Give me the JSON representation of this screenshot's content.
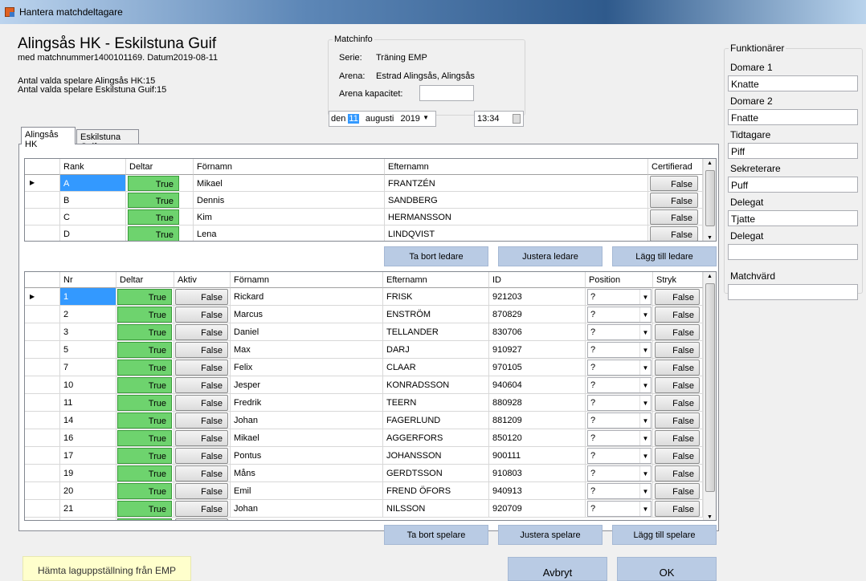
{
  "window": {
    "title": "Hantera matchdeltagare"
  },
  "header": {
    "title": "Alingsås HK - Eskilstuna Guif",
    "subtitle": "med matchnummer1400101169. Datum2019-08-11",
    "selected_home": "Antal valda spelare Alingsås HK:15",
    "selected_away": "Antal valda spelare Eskilstuna Guif:15"
  },
  "matchinfo": {
    "legend": "Matchinfo",
    "serie_label": "Serie:",
    "serie_value": "Träning EMP",
    "arena_label": "Arena:",
    "arena_value": "Estrad Alingsås, Alingsås",
    "capacity_label": "Arena kapacitet:",
    "capacity_value": ""
  },
  "date": {
    "prefix": "den",
    "day": "11",
    "month": "augusti",
    "year": "2019",
    "time": "13:34"
  },
  "tabs": [
    "Alingsås HK",
    "Eskilstuna Guif"
  ],
  "leaders_grid": {
    "columns": [
      "Rank",
      "Deltar",
      "Förnamn",
      "Efternamn",
      "Certifierad"
    ],
    "rows": [
      {
        "rank": "A",
        "deltar": "True",
        "fornamn": "Mikael",
        "efternamn": "FRANTZÉN",
        "cert": "False"
      },
      {
        "rank": "B",
        "deltar": "True",
        "fornamn": "Dennis",
        "efternamn": "SANDBERG",
        "cert": "False"
      },
      {
        "rank": "C",
        "deltar": "True",
        "fornamn": "Kim",
        "efternamn": "HERMANSSON",
        "cert": "False"
      },
      {
        "rank": "D",
        "deltar": "True",
        "fornamn": "Lena",
        "efternamn": "LINDQVIST",
        "cert": "False"
      }
    ]
  },
  "leader_buttons": {
    "remove": "Ta bort ledare",
    "adjust": "Justera ledare",
    "add": "Lägg till ledare"
  },
  "players_grid": {
    "columns": [
      "Nr",
      "Deltar",
      "Aktiv",
      "Förnamn",
      "Efternamn",
      "ID",
      "Position",
      "Stryk"
    ],
    "rows": [
      {
        "nr": "1",
        "deltar": "True",
        "aktiv": "False",
        "fornamn": "Rickard",
        "efternamn": "FRISK",
        "id": "921203",
        "pos": "?",
        "stryk": "False"
      },
      {
        "nr": "2",
        "deltar": "True",
        "aktiv": "False",
        "fornamn": "Marcus",
        "efternamn": "ENSTRÖM",
        "id": "870829",
        "pos": "?",
        "stryk": "False"
      },
      {
        "nr": "3",
        "deltar": "True",
        "aktiv": "False",
        "fornamn": "Daniel",
        "efternamn": "TELLANDER",
        "id": "830706",
        "pos": "?",
        "stryk": "False"
      },
      {
        "nr": "5",
        "deltar": "True",
        "aktiv": "False",
        "fornamn": "Max",
        "efternamn": "DARJ",
        "id": "910927",
        "pos": "?",
        "stryk": "False"
      },
      {
        "nr": "7",
        "deltar": "True",
        "aktiv": "False",
        "fornamn": "Felix",
        "efternamn": "CLAAR",
        "id": "970105",
        "pos": "?",
        "stryk": "False"
      },
      {
        "nr": "10",
        "deltar": "True",
        "aktiv": "False",
        "fornamn": "Jesper",
        "efternamn": "KONRADSSON",
        "id": "940604",
        "pos": "?",
        "stryk": "False"
      },
      {
        "nr": "11",
        "deltar": "True",
        "aktiv": "False",
        "fornamn": "Fredrik",
        "efternamn": "TEERN",
        "id": "880928",
        "pos": "?",
        "stryk": "False"
      },
      {
        "nr": "14",
        "deltar": "True",
        "aktiv": "False",
        "fornamn": "Johan",
        "efternamn": "FAGERLUND",
        "id": "881209",
        "pos": "?",
        "stryk": "False"
      },
      {
        "nr": "16",
        "deltar": "True",
        "aktiv": "False",
        "fornamn": "Mikael",
        "efternamn": "AGGERFORS",
        "id": "850120",
        "pos": "?",
        "stryk": "False"
      },
      {
        "nr": "17",
        "deltar": "True",
        "aktiv": "False",
        "fornamn": "Pontus",
        "efternamn": "JOHANSSON",
        "id": "900111",
        "pos": "?",
        "stryk": "False"
      },
      {
        "nr": "19",
        "deltar": "True",
        "aktiv": "False",
        "fornamn": "Måns",
        "efternamn": "GERDTSSON",
        "id": "910803",
        "pos": "?",
        "stryk": "False"
      },
      {
        "nr": "20",
        "deltar": "True",
        "aktiv": "False",
        "fornamn": "Emil",
        "efternamn": "FREND ÖFORS",
        "id": "940913",
        "pos": "?",
        "stryk": "False"
      },
      {
        "nr": "21",
        "deltar": "True",
        "aktiv": "False",
        "fornamn": "Johan",
        "efternamn": "NILSSON",
        "id": "920709",
        "pos": "?",
        "stryk": "False"
      }
    ]
  },
  "player_buttons": {
    "remove": "Ta bort spelare",
    "adjust": "Justera spelare",
    "add": "Lägg till spelare"
  },
  "officials": {
    "legend": "Funktionärer",
    "items": [
      {
        "label": "Domare 1",
        "value": "Knatte"
      },
      {
        "label": "Domare 2",
        "value": "Fnatte"
      },
      {
        "label": "Tidtagare",
        "value": "Piff"
      },
      {
        "label": "Sekreterare",
        "value": "Puff"
      },
      {
        "label": "Delegat",
        "value": "Tjatte"
      },
      {
        "label": "Delegat",
        "value": ""
      },
      {
        "label": "Matchvärd",
        "value": ""
      }
    ]
  },
  "footer": {
    "fetch": "Hämta laguppställning från EMP",
    "cancel": "Avbryt",
    "ok": "OK"
  },
  "colors": {
    "green": "#6ed36e",
    "selected": "#3399ff",
    "action_button": "#b9cbe4",
    "fetch_button": "#ffffcc"
  }
}
